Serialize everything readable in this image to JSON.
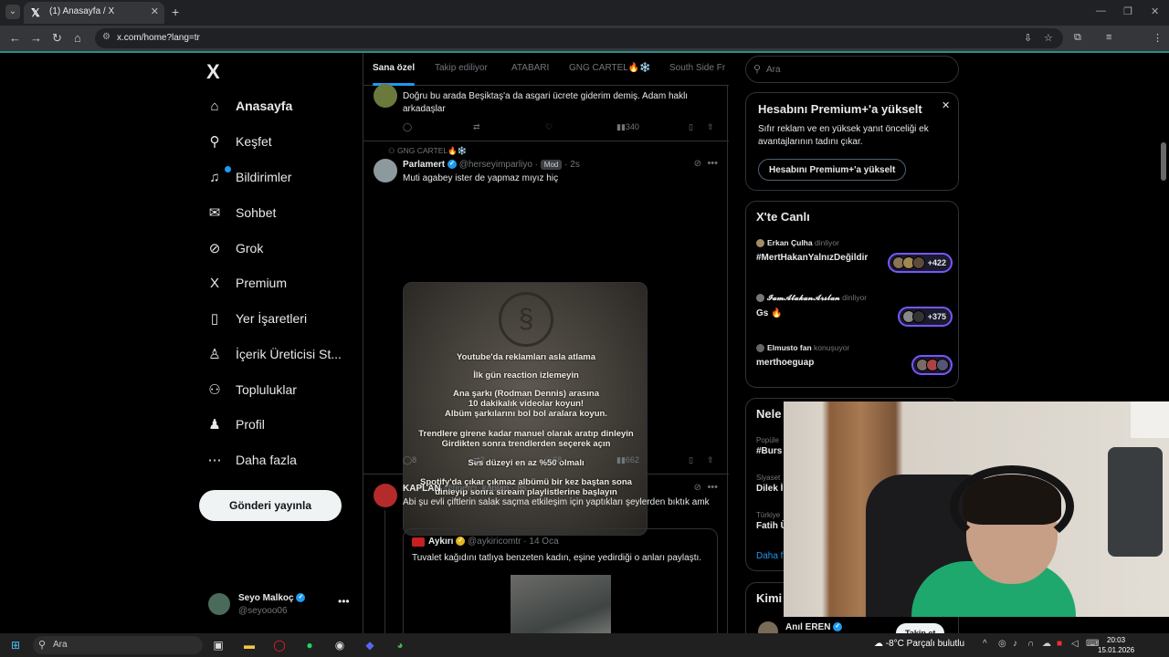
{
  "browser": {
    "tab_title": "(1) Anasayfa / X",
    "url": "x.com/home?lang=tr",
    "icons": [
      "back-icon",
      "forward-icon",
      "reload-icon",
      "home-icon",
      "site-info-icon",
      "install-icon",
      "star-icon",
      "extensions-icon",
      "media-icon",
      "profile-icon",
      "menu-icon"
    ]
  },
  "left_nav": {
    "logo": "X",
    "items": [
      {
        "label": "Anasayfa",
        "icon": "⌂"
      },
      {
        "label": "Keşfet",
        "icon": "⚲"
      },
      {
        "label": "Bildirimler",
        "icon": "♫",
        "badge": "1"
      },
      {
        "label": "Sohbet",
        "icon": "✉"
      },
      {
        "label": "Grok",
        "icon": "⊘"
      },
      {
        "label": "Premium",
        "icon": "X"
      },
      {
        "label": "Yer İşaretleri",
        "icon": "▯"
      },
      {
        "label": "İçerik Üreticisi St...",
        "icon": "♙"
      },
      {
        "label": "Topluluklar",
        "icon": "⚇"
      },
      {
        "label": "Profil",
        "icon": "♟"
      },
      {
        "label": "Daha fazla",
        "icon": "⋯"
      }
    ],
    "post_button": "Gönderi yayınla",
    "profile": {
      "name": "Seyo Malkoç",
      "handle": "@seyooo06",
      "more": "•••"
    }
  },
  "timeline": {
    "tabs": [
      "Sana özel",
      "Takip ediliyor",
      "ATABARI",
      "GNG CARTEL🔥❄️",
      "South Side Fr"
    ],
    "posts": [
      {
        "text": "Doğru bu arada Beşiktaş'a da asgari ücrete giderim demiş. Adam haklı arkadaşlar",
        "views": "340"
      },
      {
        "community": "GNG CARTEL🔥❄️",
        "name": "Parlamert",
        "handle": "@herseyimparliyo",
        "badge": "Mod",
        "time": "2s",
        "text": "Muti agabey ister de yapmaz mıyız hiç",
        "image_lines": [
          "Youtube'da reklamları asla atlama",
          "İlk gün reaction izlemeyin",
          "Ana şarkı (Rodman Dennis) arasına",
          "10 dakikalık videolar koyun!",
          "Albüm şarkılarını bol bol aralara koyun.",
          "Trendlere girene kadar manuel olarak aratıp dinleyin",
          "Girdikten sonra trendlerden seçerek açın",
          "Ses düzeyi en az %50 olmalı",
          "Spotify'da çıkar çıkmaz albümü bir kez baştan sona",
          "dinleyip sonra stream playlistlerine başlayın"
        ],
        "replies": "8",
        "reposts": "2",
        "likes": "68",
        "views": "662"
      },
      {
        "name": "KAPLAN",
        "handle": "@tinerci_kaplan",
        "time": "8s",
        "text": "Abi şu evli çiftlerin salak saçma etkileşim için yaptıkları şeylerden  bıktık amk",
        "quote": {
          "name": "Aykırı",
          "handle": "@aykiricomtr",
          "time": "14 Oca",
          "text": "Tuvalet kağıdını tatlıya benzeten kadın, eşine yedirdiği o anları paylaştı."
        }
      }
    ]
  },
  "sidebar": {
    "search_placeholder": "Ara",
    "premium": {
      "title": "Hesabını Premium+'a yükselt",
      "text": "Sıfır reklam ve en yüksek yanıt önceliği ek avantajlarının tadını çıkar.",
      "button": "Hesabını Premium+'a yükselt"
    },
    "live": {
      "title": "X'te Canlı",
      "items": [
        {
          "host": "Erkan Çulha",
          "status": "dinliyor",
          "title": "#MertHakanYalnızDeğildir",
          "count": "+422"
        },
        {
          "host": "𝓘𝓪𝓶𝓐𝓽𝓪𝓴𝓪𝓷𝓐𝓻𝓼𝓵𝓪𝓷",
          "status": "dinliyor",
          "title": "Gs 🔥",
          "count": "+375"
        },
        {
          "host": "Elmusto fan",
          "status": "konuşuyor",
          "title": "merthoeguap",
          "count": ""
        }
      ]
    },
    "whats_happening": {
      "title": "Nele",
      "trends": [
        {
          "category": "Popüle",
          "name": "#Burs"
        },
        {
          "category": "Siyaset",
          "name": "Dilek İ"
        },
        {
          "category": "Türkiye",
          "name": "Fatih Ü"
        }
      ],
      "show_more": "Daha f"
    },
    "who_to_follow": {
      "title": "Kimi",
      "name": "Anıl EREN",
      "button": "Takip et"
    }
  },
  "taskbar": {
    "search": "Ara",
    "weather": "-8°C  Parçalı bulutlu",
    "time": "20:03",
    "date": "15.01.2026"
  }
}
